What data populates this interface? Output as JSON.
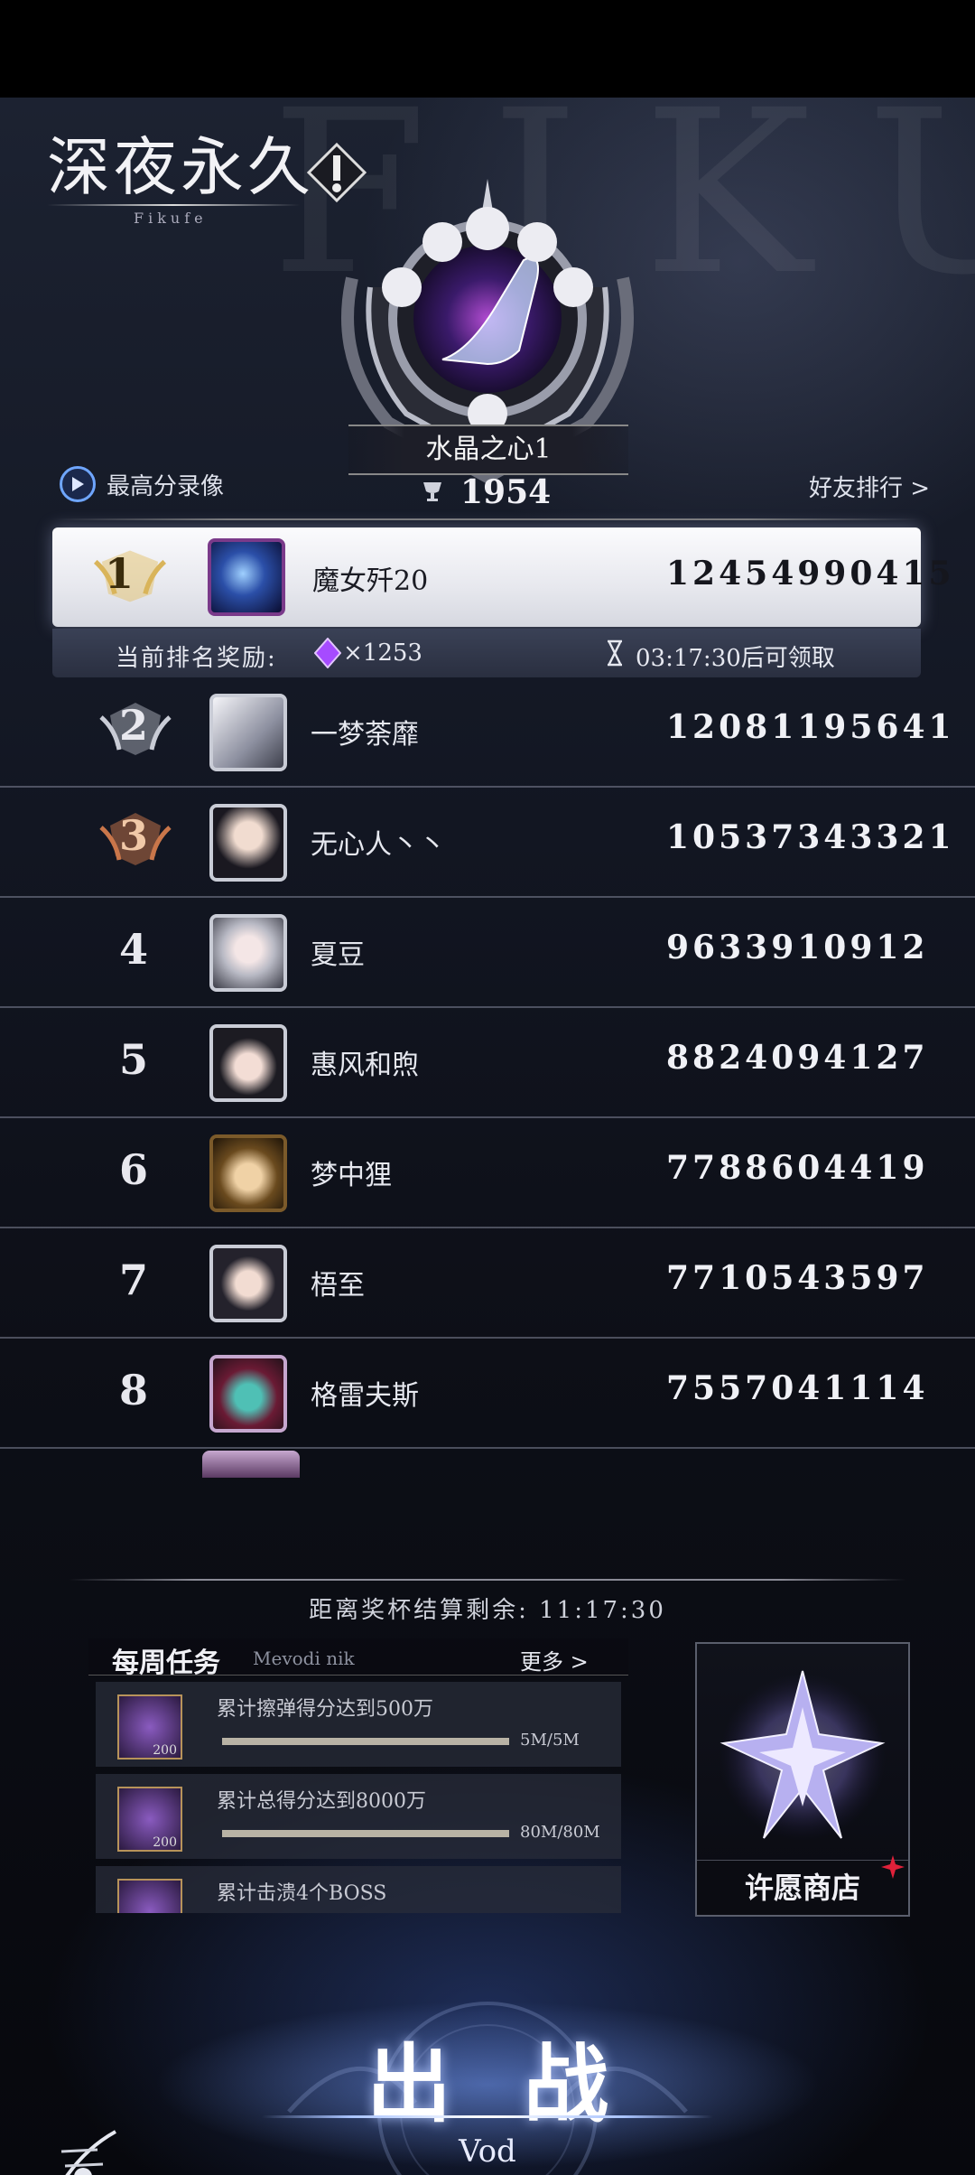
{
  "logo": {
    "title": "深夜永久",
    "subtitle": "Fikufe"
  },
  "background_text": "FIKU",
  "emblem": {
    "name": "水晶之心1",
    "trophies": "1954"
  },
  "header": {
    "replay_label": "最高分录像",
    "friends_label": "好友排行 >"
  },
  "reward": {
    "label": "当前排名奖励:",
    "count": "×1253",
    "time": "03:17:30后可领取"
  },
  "ranking": [
    {
      "rank": "1",
      "name": "魔女歼20",
      "score": "12454990415"
    },
    {
      "rank": "2",
      "name": "一梦荼靡",
      "score": "12081195641"
    },
    {
      "rank": "3",
      "name": "无心人丶丶",
      "score": "10537343321"
    },
    {
      "rank": "4",
      "name": "夏豆",
      "score": "9633910912"
    },
    {
      "rank": "5",
      "name": "惠风和煦",
      "score": "8824094127"
    },
    {
      "rank": "6",
      "name": "梦中狸",
      "score": "7788604419"
    },
    {
      "rank": "7",
      "name": "梧至",
      "score": "7710543597"
    },
    {
      "rank": "8",
      "name": "格雷夫斯",
      "score": "7557041114"
    }
  ],
  "countdown": "距离奖杯结算剩余: 11:17:30",
  "weekly_tasks": {
    "title": "每周任务",
    "subtitle": "Mevodi nik",
    "more": "更多 >",
    "items": [
      {
        "text": "累计擦弹得分达到500万",
        "progress": "5M/5M",
        "ratio": 1.0,
        "reward": "200"
      },
      {
        "text": "累计总得分达到8000万",
        "progress": "80M/80M",
        "ratio": 1.0,
        "reward": "200"
      },
      {
        "text": "累计击溃4个BOSS",
        "progress": "",
        "ratio": 0,
        "reward": ""
      }
    ]
  },
  "shop": {
    "label": "许愿商店"
  },
  "battle": {
    "label": "出战",
    "sub": "Vod"
  },
  "colors": {
    "accent_blue": "#6fa6ff",
    "gold": "#e3c26b",
    "silver": "#c9ccd6",
    "bronze": "#c9764a",
    "gem": "#a64bff"
  }
}
